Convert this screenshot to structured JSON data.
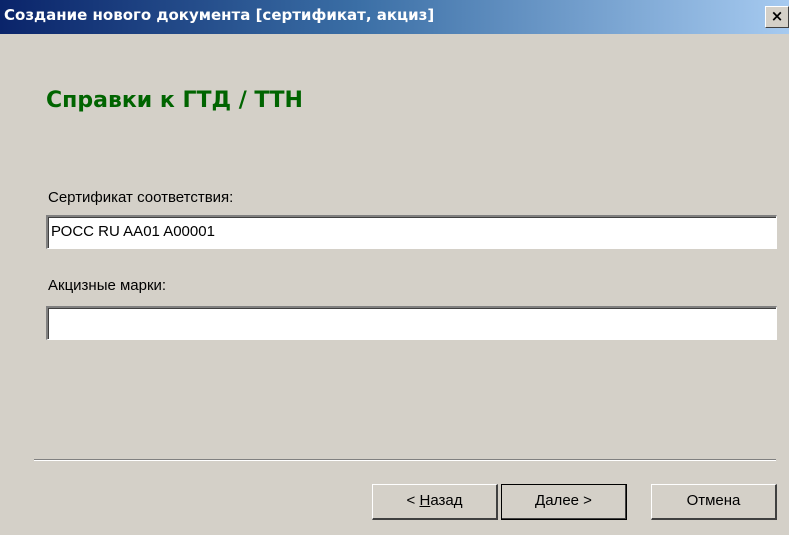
{
  "window": {
    "title": "Создание нового документа [сертификат, акциз]",
    "close_glyph": "×"
  },
  "page": {
    "heading": "Справки к ГТД / ТТН"
  },
  "form": {
    "certificate_label": "Сертификат соответствия:",
    "certificate_value": "РОСС RU AA01 A00001",
    "excise_label": "Акцизные марки:",
    "excise_value": ""
  },
  "buttons": {
    "back_prefix": "< ",
    "back_mnemonic": "Н",
    "back_rest": "азад",
    "next_mnemonic": "Д",
    "next_rest": "алее >",
    "cancel": "Отмена"
  }
}
